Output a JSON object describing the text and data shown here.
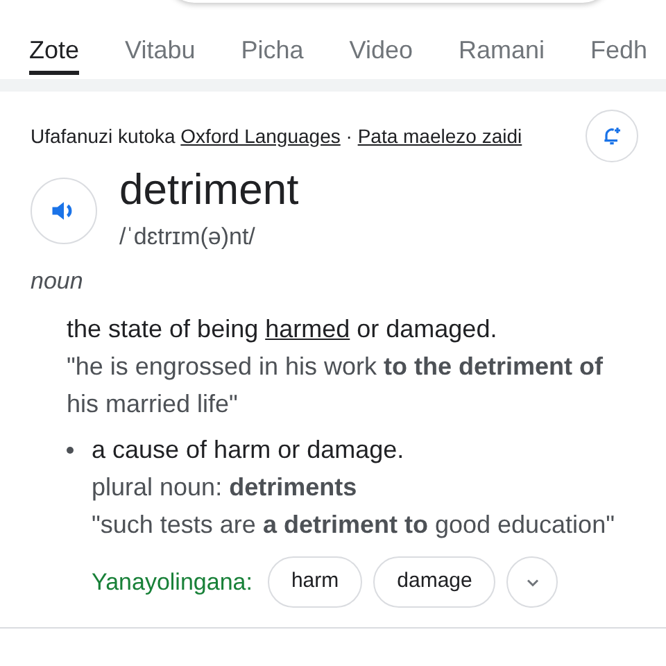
{
  "tabs": [
    {
      "label": "Zote",
      "selected": true
    },
    {
      "label": "Vitabu",
      "selected": false
    },
    {
      "label": "Picha",
      "selected": false
    },
    {
      "label": "Video",
      "selected": false
    },
    {
      "label": "Ramani",
      "selected": false
    },
    {
      "label": "Fedh",
      "selected": false
    }
  ],
  "source": [
    {
      "text": "Ufafanuzi kutoka ",
      "link": false
    },
    {
      "text": "Oxford Languages",
      "link": true
    },
    {
      "text": " · ",
      "link": false
    },
    {
      "text": "Pata maelezo zaidi",
      "link": true
    }
  ],
  "word": "detriment",
  "pronunciation": "/ˈdɛtrɪm(ə)nt/",
  "part_of_speech": "noun",
  "senses": [
    {
      "bullet": false,
      "definition": [
        {
          "text": "the state of being ",
          "link": false
        },
        {
          "text": "harmed",
          "link": true
        },
        {
          "text": " or damaged.",
          "link": false
        }
      ],
      "example": "\"he is engrossed in his work **to the detriment of** his married life\""
    },
    {
      "bullet": true,
      "definition": [
        {
          "text": "a cause of harm or damage.",
          "link": false
        }
      ],
      "grammar": "plural noun: **detriments**",
      "example": "\"such tests are **a detriment to** good education\""
    }
  ],
  "synonyms_label": "Yanayolingana:",
  "synonyms": [
    "harm",
    "damage"
  ]
}
